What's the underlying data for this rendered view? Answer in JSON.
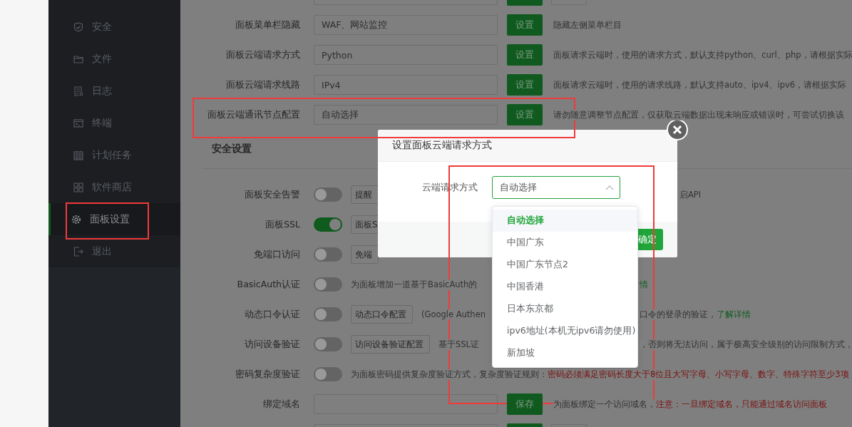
{
  "sidebar": {
    "items": [
      {
        "label": "安全",
        "kind": "shield",
        "selected": false
      },
      {
        "label": "文件",
        "kind": "folder",
        "selected": false
      },
      {
        "label": "日志",
        "kind": "log",
        "selected": false
      },
      {
        "label": "终端",
        "kind": "terminal",
        "selected": false
      },
      {
        "label": "计划任务",
        "kind": "calendar",
        "selected": false
      },
      {
        "label": "软件商店",
        "kind": "grid",
        "selected": false
      },
      {
        "label": "面板设置",
        "kind": "gear",
        "selected": true
      },
      {
        "label": "退出",
        "kind": "exit",
        "selected": false
      }
    ]
  },
  "settings_rows": [
    {
      "kind": "stub"
    },
    {
      "kind": "input",
      "label": "面板菜单栏隐藏",
      "value": "WAF、网站监控",
      "button": "设置",
      "description": "隐藏左侧菜单栏目"
    },
    {
      "kind": "input",
      "label": "面板云端请求方式",
      "value": "Python",
      "button": "设置",
      "description": "面板请求云端时，使用的请求方式，默认支持python、curl、php，请根据实际"
    },
    {
      "kind": "input",
      "label": "面板云端请求线路",
      "value": "IPv4",
      "button": "设置",
      "description": "面板请求云端时，使用的请求线路，默认支持auto、ipv4、ipv6，请根据实际"
    },
    {
      "kind": "input",
      "label": "面板云端通讯节点配置",
      "value": "自动选择",
      "button": "设置",
      "description": "请勿随意调整节点配置，仅获取云端数据出现未响应或错误时，可尝试切换该"
    }
  ],
  "section_title": "安全设置",
  "security_rows": [
    {
      "kind": "toggle",
      "label": "面板安全告警",
      "on": false,
      "button": "提醒",
      "tail": "启API"
    },
    {
      "kind": "toggle",
      "label": "面板SSL",
      "on": true,
      "button": "面板S"
    },
    {
      "kind": "toggle",
      "label": "免端口访问",
      "on": false,
      "button": "免端"
    },
    {
      "kind": "toggle",
      "label": "BasicAuth认证",
      "on": false,
      "description": "为面板增加一道基于BasicAuth的",
      "tail_link": "情"
    },
    {
      "kind": "toggle",
      "label": "动态口令认证",
      "on": false,
      "button": "动态口令配置",
      "description": "(Google Authen",
      "tail": "口令的登录的验证，",
      "tail_link": "了解详情"
    },
    {
      "kind": "toggle",
      "label": "访问设备验证",
      "on": false,
      "button": "访问设备验证配置",
      "description": "基于SSL证",
      "tail": "，否则将无法访问，属于极高安全级别的访问限制方式，"
    },
    {
      "kind": "toggle",
      "label": "密码复杂度验证",
      "on": false,
      "description": "为面板密码提供复杂度验证方式，复杂度验证规则：",
      "warning": "密码必须满足密码长度大于8位且大写字母、小写字母、数字、特殊字符至少3项"
    },
    {
      "kind": "input",
      "label": "绑定域名",
      "button": "保存",
      "description": "为面板绑定一个访问域名，",
      "warning": "注意：一旦绑定域名，只能通过域名访问面板"
    },
    {
      "kind": "stub"
    }
  ],
  "dialog": {
    "title": "设置面板云端请求方式",
    "field_label": "云端请求方式",
    "field_value": "自动选择",
    "confirm_button": "确定"
  },
  "dropdown": {
    "options": [
      {
        "label": "自动选择",
        "selected": true
      },
      {
        "label": "中国广东",
        "selected": false
      },
      {
        "label": "中国广东节点2",
        "selected": false
      },
      {
        "label": "中国香港",
        "selected": false
      },
      {
        "label": "日本东京都",
        "selected": false
      },
      {
        "label": "ipv6地址(本机无ipv6请勿使用)",
        "selected": false
      },
      {
        "label": "新加坡",
        "selected": false
      }
    ]
  }
}
